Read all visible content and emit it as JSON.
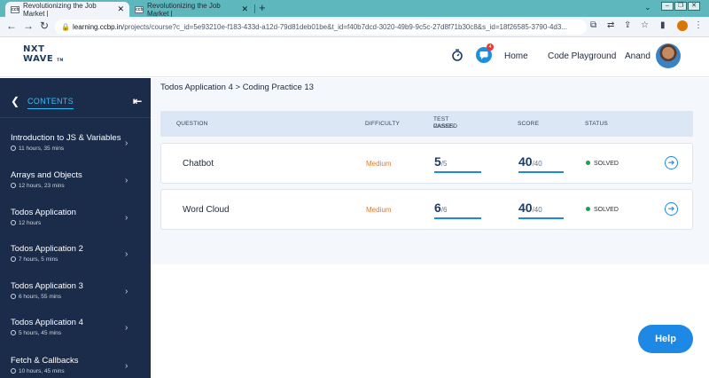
{
  "browser": {
    "tabs": [
      {
        "label": "Revolutionizing the Job Market |",
        "close": "✕"
      },
      {
        "label": "Revolutionizing the Job Market |",
        "close": "✕"
      }
    ],
    "new_tab": "+",
    "url_host": "learning.ccbp.in",
    "url_path": "/projects/course?c_id=5e93210e-f183-433d-a12d-79d81deb01be&t_id=f40b7dcd-3020-49b9-9c5c-27d8f71b30c8&s_id=18f26585-3790-4d3..."
  },
  "header": {
    "logo_line1": "NXT",
    "logo_line2": "WAVE",
    "logo_tm": "TM",
    "notification_count": "4",
    "links": [
      "Home",
      "Code Playground",
      "Anand"
    ]
  },
  "sidebar": {
    "title": "CONTENTS",
    "items": [
      {
        "name": "Introduction to JS & Variables",
        "duration": "11 hours, 35 mins"
      },
      {
        "name": "Arrays and Objects",
        "duration": "12 hours, 23 mins"
      },
      {
        "name": "Todos Application",
        "duration": "12 hours"
      },
      {
        "name": "Todos Application 2",
        "duration": "7 hours, 5 mins"
      },
      {
        "name": "Todos Application 3",
        "duration": "6 hours, 55 mins"
      },
      {
        "name": "Todos Application 4",
        "duration": "5 hours, 45 mins"
      },
      {
        "name": "Fetch & Callbacks",
        "duration": "10 hours, 45 mins"
      }
    ]
  },
  "main": {
    "breadcrumb": "Todos Application 4 > Coding Practice 13",
    "columns": {
      "question": "QUESTION",
      "difficulty": "DIFFICULTY",
      "test_cases_1": "TEST CASES",
      "test_cases_2": "PASSED",
      "score": "SCORE",
      "status": "STATUS"
    },
    "rows": [
      {
        "question": "Chatbot",
        "difficulty": "Medium",
        "passed": "5",
        "passed_total": "/5",
        "score": "40",
        "score_total": "/40",
        "status": "SOLVED"
      },
      {
        "question": "Word Cloud",
        "difficulty": "Medium",
        "passed": "6",
        "passed_total": "/6",
        "score": "40",
        "score_total": "/40",
        "status": "SOLVED"
      }
    ]
  },
  "help_label": "Help",
  "colors": {
    "sidebar_bg": "#1b2b4a",
    "accent": "#1e88e5",
    "difficulty_medium": "#e8782a",
    "solved_dot": "#16a34a"
  }
}
